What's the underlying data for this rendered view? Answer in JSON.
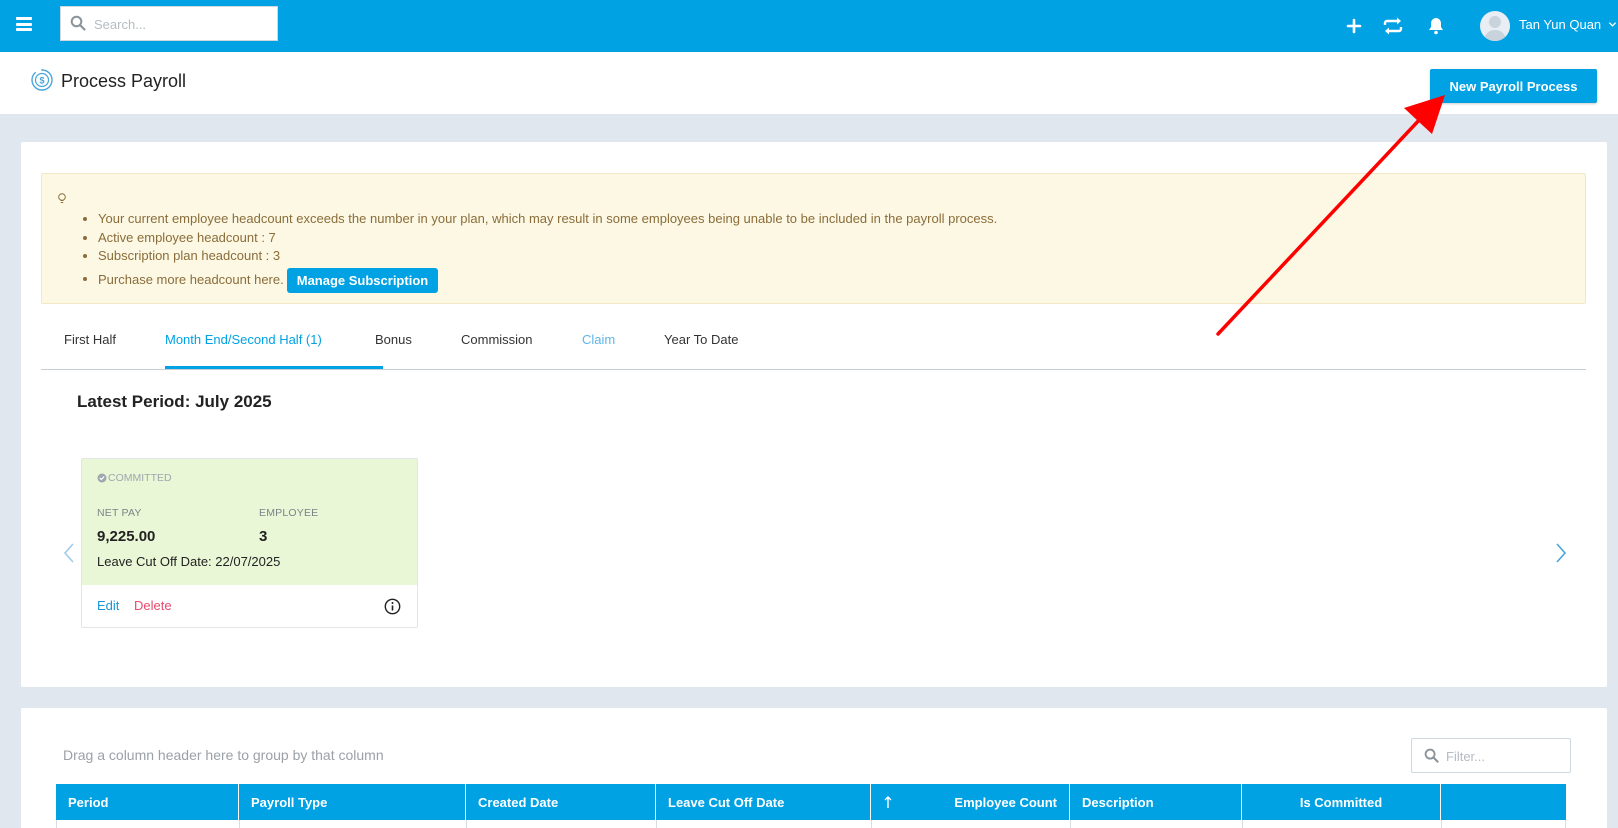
{
  "header": {
    "search_placeholder": "Search...",
    "user_name": "Tan Yun Quan"
  },
  "page": {
    "title": "Process Payroll",
    "new_payroll_button": "New Payroll Process"
  },
  "alert": {
    "items": [
      "Your current employee headcount exceeds the number in your plan, which may result in some employees being unable to be included in the payroll process.",
      "Active employee headcount : 7",
      "Subscription plan headcount : 3",
      "Purchase more headcount here."
    ],
    "manage_button": "Manage Subscription"
  },
  "tabs": [
    {
      "label": "First Half"
    },
    {
      "label": "Month End/Second Half (1)"
    },
    {
      "label": "Bonus"
    },
    {
      "label": "Commission"
    },
    {
      "label": "Claim"
    },
    {
      "label": "Year To Date"
    }
  ],
  "latest_period": "Latest Period: July 2025",
  "period_card": {
    "status": "COMMITTED",
    "net_pay_label": "NET PAY",
    "net_pay_value": "9,225.00",
    "employee_label": "EMPLOYEE",
    "employee_value": "3",
    "cutoff": "Leave Cut Off Date: 22/07/2025",
    "edit": "Edit",
    "delete": "Delete"
  },
  "grid": {
    "group_hint": "Drag a column header here to group by that column",
    "filter_placeholder": "Filter...",
    "columns": [
      "Period",
      "Payroll Type",
      "Created Date",
      "Leave Cut Off Date",
      "Employee Count",
      "Description",
      "Is Committed"
    ]
  },
  "colors": {
    "primary": "#00a2e3",
    "alert_bg": "#fcf8e3",
    "alert_text": "#8a6d3b",
    "committed_bg": "#eaf7d6",
    "delete": "#e84a6d"
  },
  "annotation": {
    "type": "red-arrow",
    "points_to": "new-payroll-button",
    "color": "#ff0000"
  }
}
